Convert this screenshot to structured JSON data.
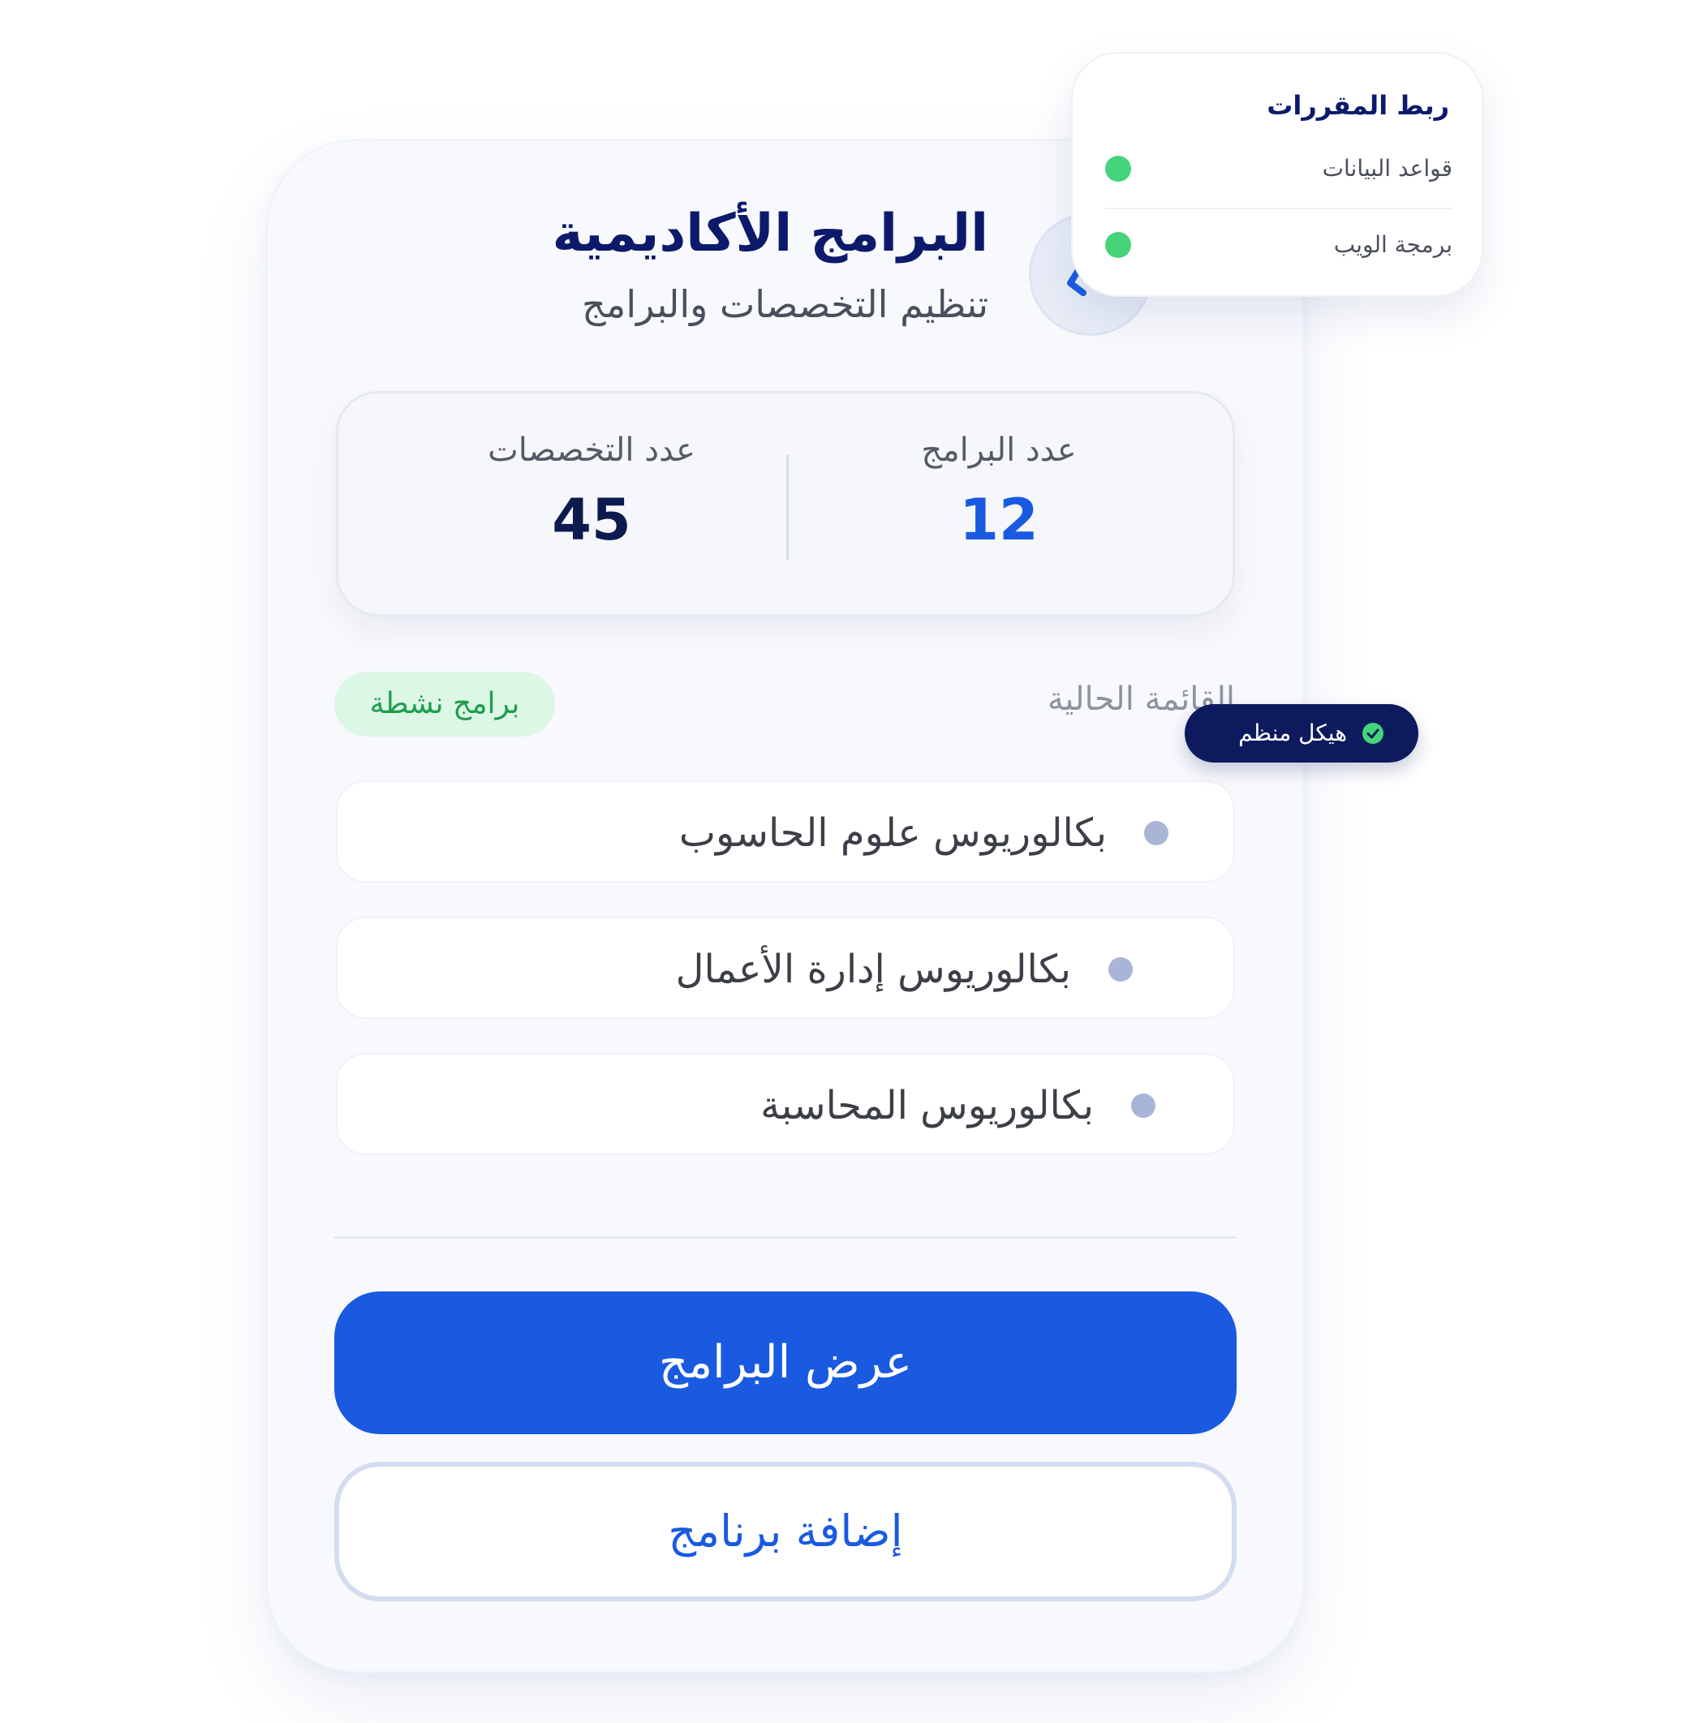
{
  "header": {
    "title": "البرامج الأكاديمية",
    "subtitle": "تنظيم التخصصات والبرامج",
    "icon": "hierarchy-icon"
  },
  "stats": {
    "programs": {
      "label": "عدد البرامج",
      "value": "12"
    },
    "specialties": {
      "label": "عدد التخصصات",
      "value": "45"
    }
  },
  "list_section": {
    "title": "القائمة الحالية",
    "badge": "برامج نشطة"
  },
  "programs": [
    {
      "label": "بكالوريوس علوم الحاسوب"
    },
    {
      "label": "بكالوريوس إدارة الأعمال"
    },
    {
      "label": "بكالوريوس المحاسبة"
    }
  ],
  "actions": {
    "view_programs": "عرض البرامج",
    "add_program": "إضافة برنامج"
  },
  "course_linking": {
    "title": "ربط المقررات",
    "items": [
      {
        "label": "قواعد البيانات"
      },
      {
        "label": "برمجة الويب"
      }
    ]
  },
  "structure_pill": {
    "label": "هيكل منظم",
    "icon": "check-circle-icon"
  },
  "colors": {
    "primary": "#1a5ae0",
    "navy": "#0d1a6b",
    "success": "#45d47a",
    "badge_bg": "#dcf7e5",
    "badge_text": "#1d9e4e"
  }
}
